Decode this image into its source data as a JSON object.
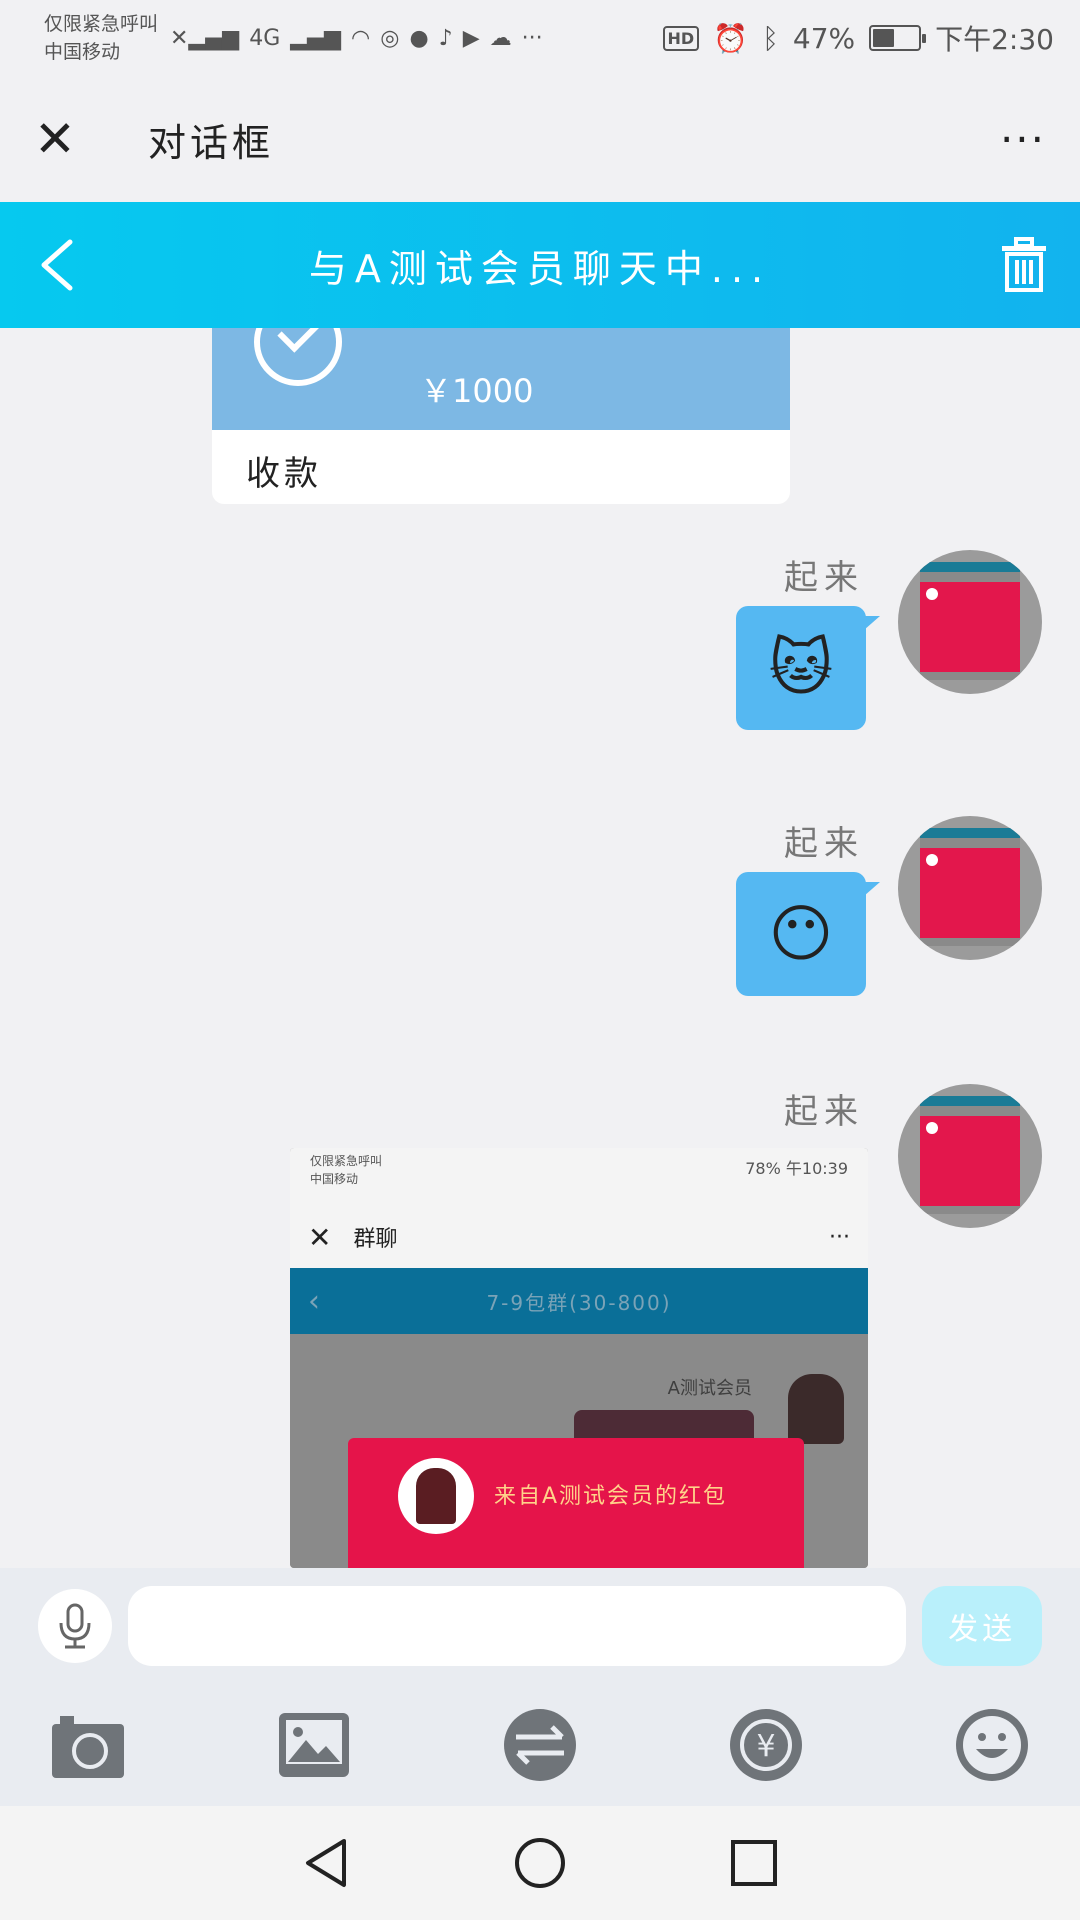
{
  "statusbar": {
    "carrier_line1": "仅限紧急呼叫",
    "carrier_line2": "中国移动",
    "network": "4G",
    "battery_text": "47%",
    "battery_level": 0.47,
    "time": "下午2:30",
    "hd": "HD"
  },
  "app": {
    "title": "对话框",
    "more": "···"
  },
  "chat": {
    "title": "与A测试会员聊天中..."
  },
  "messages": {
    "receipt": {
      "amount": "￥1000",
      "label": "收款"
    },
    "items": [
      {
        "sender": "起来",
        "emoji": "🐱"
      },
      {
        "sender": "起来",
        "emoji": "😶"
      },
      {
        "sender": "起来"
      }
    ],
    "screenshot": {
      "carrier_line1": "仅限紧急呼叫",
      "carrier_line2": "中国移动",
      "status_right": "78% 午10:39",
      "title": "群聊",
      "more": "···",
      "group_name": "7-9包群(30-800)",
      "member": "A测试会员",
      "redpacket_text": "来自A测试会员的红包"
    }
  },
  "input": {
    "placeholder": "",
    "value": "",
    "send_label": "发送"
  },
  "toolbar": {
    "items": [
      "camera-icon",
      "image-icon",
      "transfer-icon",
      "yuan-exchange-icon",
      "emoji-icon"
    ]
  },
  "colors": {
    "header_gradient_start": "#06c9ef",
    "header_gradient_end": "#12b3ee",
    "bubble": "#55b8f2",
    "send_button": "#b9f0fb",
    "red_packet": "#e5144a"
  }
}
